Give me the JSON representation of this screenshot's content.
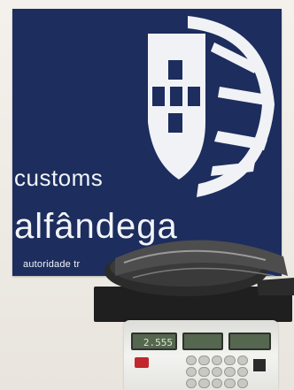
{
  "banner": {
    "line1": "customs",
    "line2": "alfândega",
    "line3": "autoridade tr"
  },
  "scale": {
    "brand": "",
    "display_weight": "2.555"
  },
  "colors": {
    "banner_blue": "#1c2d5e",
    "emblem_white": "#f1f2f6",
    "display_green": "#55674f",
    "scale_red_key": "#c1272d",
    "tire_dark": "#2b2b2b"
  }
}
